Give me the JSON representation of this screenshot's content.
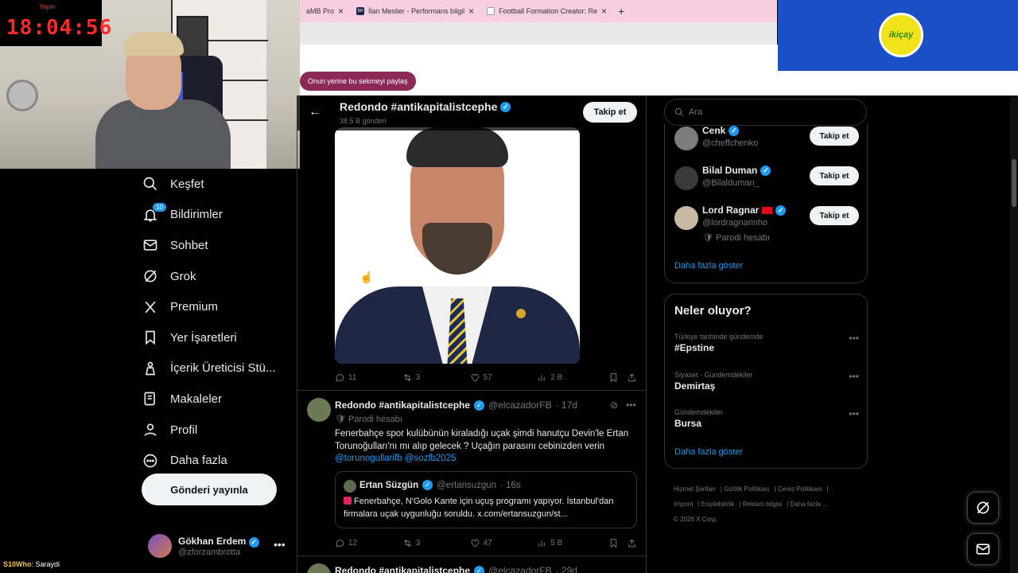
{
  "browser": {
    "tabs": [
      {
        "label": "aMB Pro",
        "favicon": ""
      },
      {
        "label": "İlan Meslier - Performans bilgil",
        "favicon": "tm"
      },
      {
        "label": "Football Formation Creator: Re",
        "favicon": ""
      }
    ],
    "share_pill": "Onun yerine bu sekmeyi paylaş"
  },
  "sponsor": {
    "logo_text": "ikiçay"
  },
  "stream": {
    "clock_label": "Yayın",
    "clock_time": "18:04:56",
    "ticker_user": "S10Who",
    "ticker_text": ": Saraydi"
  },
  "nav": {
    "items": [
      {
        "label": "Keşfet",
        "icon": "search-icon"
      },
      {
        "label": "Bildirimler",
        "icon": "bell-icon",
        "badge": "10"
      },
      {
        "label": "Sohbet",
        "icon": "mail-icon"
      },
      {
        "label": "Grok",
        "icon": "grok-icon"
      },
      {
        "label": "Premium",
        "icon": "x-logo-icon"
      },
      {
        "label": "Yer İşaretleri",
        "icon": "bookmark-icon"
      },
      {
        "label": "İçerik Üreticisi Stü...",
        "icon": "creator-icon"
      },
      {
        "label": "Makaleler",
        "icon": "article-icon"
      },
      {
        "label": "Profil",
        "icon": "person-icon"
      },
      {
        "label": "Daha fazla",
        "icon": "more-circle-icon"
      }
    ],
    "post_button": "Gönderi yayınla",
    "account": {
      "name": "Gökhan Erdem",
      "handle": "@zforzambrotta"
    }
  },
  "profile_header": {
    "name": "Redondo #antikapitalistcephe",
    "sub": "38.5 B gönderi",
    "follow": "Takip et"
  },
  "tweets": [
    {
      "stats": {
        "replies": "11",
        "reposts": "3",
        "likes": "57",
        "views": "2 B"
      }
    },
    {
      "name": "Redondo #antikapitalistcephe",
      "handle": "@elcazadorFB",
      "time": "· 17d",
      "parody": "Parodi hesabı",
      "text": "Fenerbahçe spor kulübünün kiraladığı uçak şimdi hanutçu Devin'le Ertan Torunoğulları'nı mı alıp gelecek ? Uçağın parasını cebinizden verin",
      "mentions": "@torunogullarifb @sozfb2025",
      "quote": {
        "name": "Ertan Süzgün",
        "handle": "@ertansuzgun",
        "time": "· 16s",
        "text": "Fenerbahçe, N'Golo Kante için uçuş programı yapıyor. İstanbul'dan firmalara uçak uygunluğu soruldu. x.com/ertansuzgun/st..."
      },
      "stats": {
        "replies": "12",
        "reposts": "3",
        "likes": "47",
        "views": "5 B"
      }
    },
    {
      "name": "Redondo #antikapitalistcephe",
      "handle": "@elcazadorFB",
      "time": "· 29d"
    }
  ],
  "right": {
    "search_placeholder": "Ara",
    "who_to_follow": [
      {
        "name": "Cenk",
        "handle": "@cheffchenko",
        "button": "Takip et"
      },
      {
        "name": "Bilal Duman",
        "handle": "@Bilalduman_",
        "button": "Takip et"
      },
      {
        "name": "Lord Ragnar",
        "handle": "@lordragnarinho",
        "extra": "Parodi hesabı",
        "button": "Takip et"
      }
    ],
    "show_more": "Daha fazla göster",
    "trends_title": "Neler oluyor?",
    "trends": [
      {
        "context": "Türkiye tarihinde gündemde",
        "name": "#Epstine"
      },
      {
        "context": "Siyaset · Gündemdekiler",
        "name": "Demirtaş"
      },
      {
        "context": "Gündemdekiler",
        "name": "Bursa"
      }
    ],
    "trends_more": "Daha fazla göster",
    "footer": {
      "links": [
        "Hizmet Şartları",
        "Gizlilik Politikası",
        "Çerez Politikası",
        "Imprint",
        "Erişilebilirlik",
        "Reklam bilgisi",
        "Daha fazla ..."
      ],
      "copyright": "© 2026 X Corp."
    }
  },
  "colors": {
    "accent": "#1d9bf0",
    "background": "#000000",
    "border": "#2f3336",
    "muted": "#71767b",
    "tab_strip": "#f7cfe0",
    "sponsor": "#1a4fc8"
  }
}
